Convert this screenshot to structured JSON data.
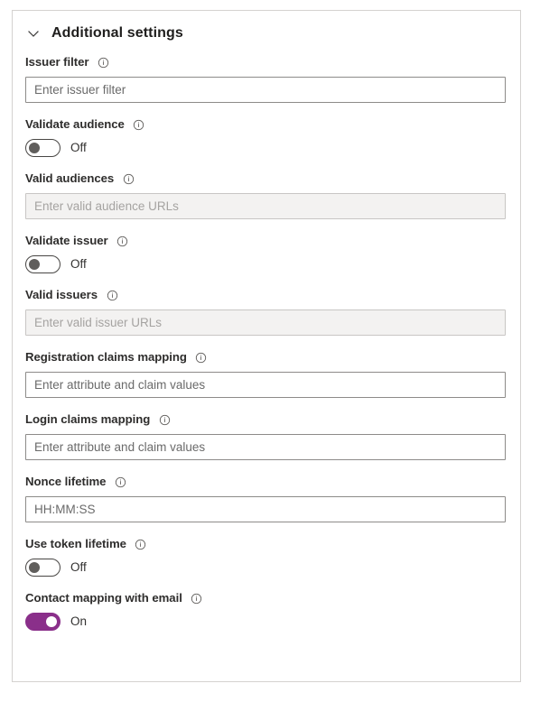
{
  "panel": {
    "title": "Additional settings",
    "collapse_icon": "chevron-down-icon",
    "info_icon": "info-circle-icon"
  },
  "fields": [
    {
      "key": "issuer_filter",
      "type": "text",
      "label": "Issuer filter",
      "placeholder": "Enter issuer filter",
      "value": "",
      "disabled": false,
      "has_info": true
    },
    {
      "key": "validate_audience",
      "type": "toggle",
      "label": "Validate audience",
      "state": "Off",
      "on": false,
      "has_info": true
    },
    {
      "key": "valid_audiences",
      "type": "text",
      "label": "Valid audiences",
      "placeholder": "Enter valid audience URLs",
      "value": "",
      "disabled": true,
      "has_info": true
    },
    {
      "key": "validate_issuer",
      "type": "toggle",
      "label": "Validate issuer",
      "state": "Off",
      "on": false,
      "has_info": true
    },
    {
      "key": "valid_issuers",
      "type": "text",
      "label": "Valid issuers",
      "placeholder": "Enter valid issuer URLs",
      "value": "",
      "disabled": true,
      "has_info": true
    },
    {
      "key": "registration_claims_mapping",
      "type": "text",
      "label": "Registration claims mapping",
      "placeholder": "Enter attribute and claim values",
      "value": "",
      "disabled": false,
      "has_info": true
    },
    {
      "key": "login_claims_mapping",
      "type": "text",
      "label": "Login claims mapping",
      "placeholder": "Enter attribute and claim values",
      "value": "",
      "disabled": false,
      "has_info": true
    },
    {
      "key": "nonce_lifetime",
      "type": "text",
      "label": "Nonce lifetime",
      "placeholder": "HH:MM:SS",
      "value": "",
      "disabled": false,
      "has_info": true
    },
    {
      "key": "use_token_lifetime",
      "type": "toggle",
      "label": "Use token lifetime",
      "state": "Off",
      "on": false,
      "has_info": true
    },
    {
      "key": "contact_mapping_with_email",
      "type": "toggle",
      "label": "Contact mapping with email",
      "state": "On",
      "on": true,
      "has_info": true
    }
  ],
  "colors": {
    "toggle_on": "#8a2f8a",
    "toggle_knob_off": "#605e5c",
    "panel_border": "#d4d2d0",
    "label_text": "#2e2d2c",
    "input_border": "#8d8b89",
    "input_disabled_bg": "#f3f2f1"
  }
}
